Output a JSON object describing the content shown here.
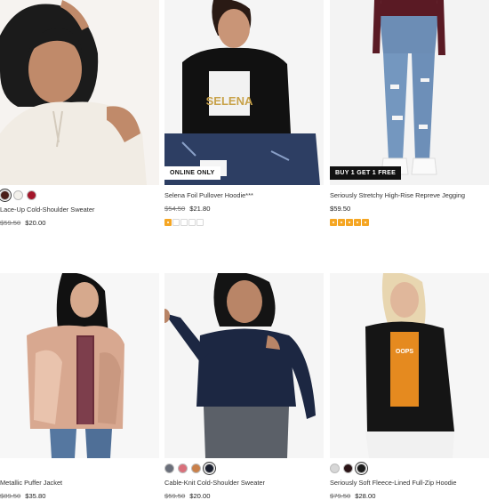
{
  "products": [
    {
      "name": "Lace-Up Cold-Shoulder Sweater",
      "original_price": "$59.50",
      "sale_price": "$20.00",
      "swatches": [
        "#4a1f1a",
        "#f3f1ec",
        "#a3162a"
      ],
      "badge": ""
    },
    {
      "name": "Selena Foil Pullover Hoodie***",
      "original_price": "$54.50",
      "sale_price": "$21.80",
      "rating": 1,
      "badge": "ONLINE ONLY"
    },
    {
      "name": "Seriously Stretchy High-Rise Repreve Jegging",
      "original_price": "",
      "sale_price": "$59.50",
      "rating": 5,
      "badge": "BUY 1 GET 1 FREE"
    },
    {
      "name": "Metallic Puffer Jacket",
      "original_price": "$89.50",
      "sale_price": "$35.80",
      "badge": ""
    },
    {
      "name": "Cable-Knit Cold-Shoulder Sweater",
      "original_price": "$59.50",
      "sale_price": "$20.00",
      "swatches": [
        "#6a6f7a",
        "#d9707b",
        "#c9804a",
        "#1a1f2e"
      ],
      "badge": ""
    },
    {
      "name": "Seriously Soft Fleece-Lined Full-Zip Hoodie",
      "original_price": "$79.50",
      "sale_price": "$28.00",
      "swatches": [
        "#d7d7d7",
        "#2a1416",
        "#1b1b1b"
      ],
      "badge": ""
    }
  ]
}
